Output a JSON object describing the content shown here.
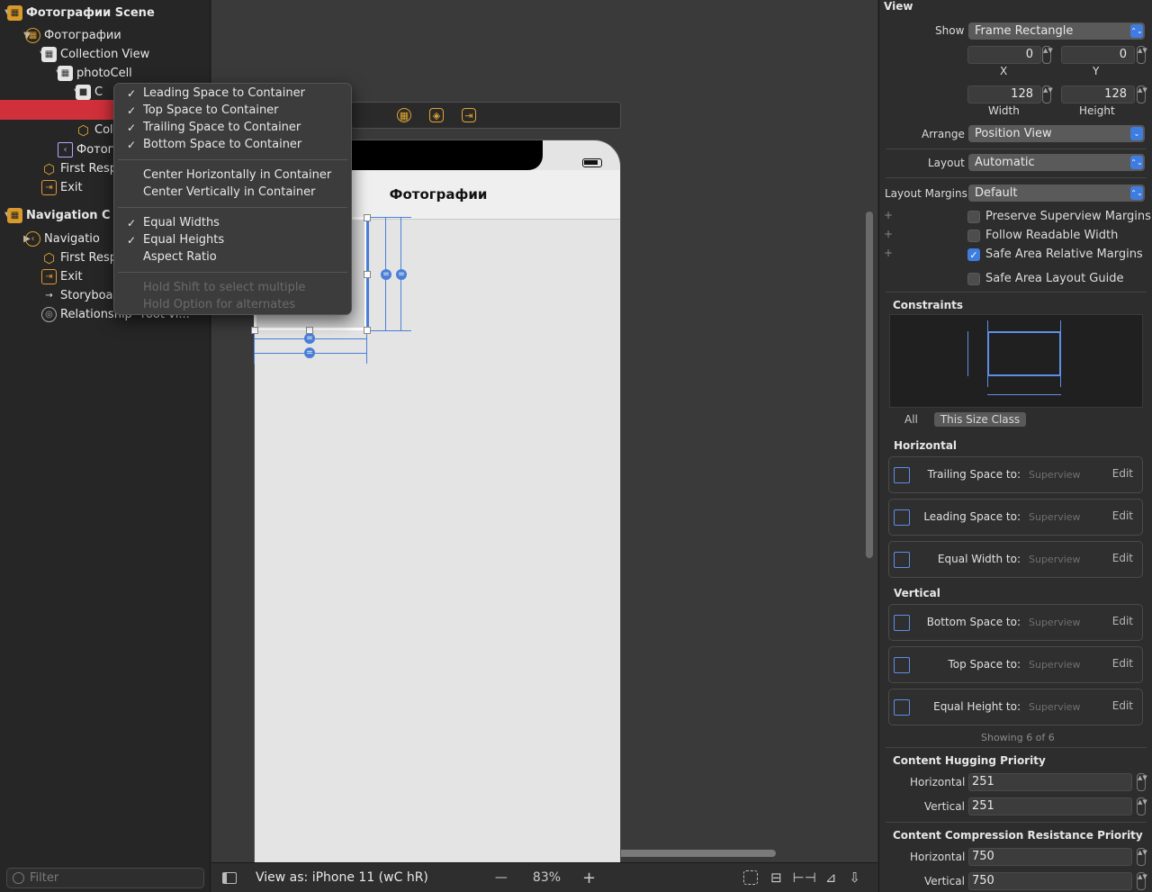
{
  "outline": {
    "items": [
      {
        "label": "Фотографии Scene",
        "icon": "scene-icon",
        "tri": "▼"
      },
      {
        "label": "Фотографии",
        "icon": "view-controller-icon",
        "tri": "▼"
      },
      {
        "label": "Collection View",
        "icon": "collection-view-icon",
        "tri": "▼"
      },
      {
        "label": "photoCell",
        "icon": "collection-cell-icon",
        "tri": "▼"
      },
      {
        "label": "C",
        "icon": "view-icon",
        "tri": "▼"
      },
      {
        "label": "",
        "icon": "",
        "tri": ""
      },
      {
        "label": "Coll",
        "icon": "cube-icon",
        "tri": ""
      },
      {
        "label": "Фотогр",
        "icon": "nav-item-icon",
        "tri": ""
      },
      {
        "label": "First Resp",
        "icon": "first-responder-icon",
        "tri": ""
      },
      {
        "label": "Exit",
        "icon": "exit-icon",
        "tri": ""
      },
      {
        "label": "Navigation C",
        "icon": "scene-icon",
        "tri": "▼"
      },
      {
        "label": "Navigatio",
        "icon": "nav-controller-icon",
        "tri": "▶"
      },
      {
        "label": "First Resp",
        "icon": "first-responder-icon",
        "tri": ""
      },
      {
        "label": "Exit",
        "icon": "exit-icon",
        "tri": ""
      },
      {
        "label": "Storyboar",
        "icon": "arrow-icon",
        "tri": ""
      },
      {
        "label": "Relationship \"root vi...",
        "icon": "relationship-icon",
        "tri": ""
      }
    ],
    "filter_placeholder": "Filter"
  },
  "context_menu": {
    "items": [
      {
        "label": "Leading Space to Container",
        "checked": true
      },
      {
        "label": "Top Space to Container",
        "checked": true
      },
      {
        "label": "Trailing Space to Container",
        "checked": true
      },
      {
        "label": "Bottom Space to Container",
        "checked": true
      },
      {
        "label": "Center Horizontally in Container",
        "checked": false
      },
      {
        "label": "Center Vertically in Container",
        "checked": false
      },
      {
        "label": "Equal Widths",
        "checked": true
      },
      {
        "label": "Equal Heights",
        "checked": true
      },
      {
        "label": "Aspect Ratio",
        "checked": false
      },
      {
        "label": "Hold Shift to select multiple",
        "checked": false
      },
      {
        "label": "Hold Option for alternates",
        "checked": false
      }
    ]
  },
  "canvas": {
    "nav_title": "Фотографии"
  },
  "bottom": {
    "view_as": "View as: iPhone 11 (",
    "size_class": "wC hR)",
    "zoom": "83%",
    "minus": "—",
    "plus": "+"
  },
  "inspector": {
    "title": "View",
    "show_label": "Show",
    "show_value": "Frame Rectangle",
    "x": "0",
    "y": "0",
    "x_label": "X",
    "y_label": "Y",
    "width": "128",
    "height": "128",
    "width_label": "Width",
    "height_label": "Height",
    "arrange_label": "Arrange",
    "arrange_value": "Position View",
    "layout_label": "Layout",
    "layout_value": "Automatic",
    "margins_label": "Layout Margins",
    "margins_value": "Default",
    "preserve": "Preserve Superview Margins",
    "follow": "Follow Readable Width",
    "safe_rel": "Safe Area Relative Margins",
    "safe_guide": "Safe Area Layout Guide",
    "constraints_title": "Constraints",
    "tab_all": "All",
    "tab_size": "This Size Class",
    "horizontal_title": "Horizontal",
    "vertical_title": "Vertical",
    "horizontal": [
      {
        "label": "Trailing Space to:",
        "target": "Superview",
        "edit": "Edit"
      },
      {
        "label": "Leading Space to:",
        "target": "Superview",
        "edit": "Edit"
      },
      {
        "label": "Equal Width to:",
        "target": "Superview",
        "edit": "Edit"
      }
    ],
    "vertical": [
      {
        "label": "Bottom Space to:",
        "target": "Superview",
        "edit": "Edit"
      },
      {
        "label": "Top Space to:",
        "target": "Superview",
        "edit": "Edit"
      },
      {
        "label": "Equal Height to:",
        "target": "Superview",
        "edit": "Edit"
      }
    ],
    "showing": "Showing 6 of 6",
    "hugging_title": "Content Hugging Priority",
    "hug_h_label": "Horizontal",
    "hug_h": "251",
    "hug_v_label": "Vertical",
    "hug_v": "251",
    "compression_title": "Content Compression Resistance Priority",
    "comp_h_label": "Horizontal",
    "comp_h": "750",
    "comp_v_label": "Vertical",
    "comp_v": "750"
  }
}
